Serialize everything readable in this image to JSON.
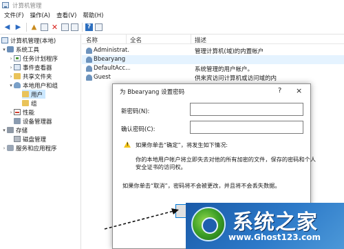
{
  "window": {
    "title": "计算机管理"
  },
  "menu": [
    "文件(F)",
    "操作(A)",
    "查看(V)",
    "帮助(H)"
  ],
  "tree": {
    "root": "计算机管理(本地)",
    "system_tools": "系统工具",
    "task_scheduler": "任务计划程序",
    "event_viewer": "事件查看器",
    "shared_folders": "共享文件夹",
    "local_users_groups": "本地用户和组",
    "users": "用户",
    "groups": "组",
    "performance": "性能",
    "device_manager": "设备管理器",
    "storage": "存储",
    "disk_management": "磁盘管理",
    "services_apps": "服务和应用程序"
  },
  "list": {
    "columns": [
      "名称",
      "全名",
      "描述"
    ],
    "rows": [
      {
        "name": "Administrat...",
        "desc": "管理计算机(域)的内置帐户"
      },
      {
        "name": "Bbearyang",
        "desc": ""
      },
      {
        "name": "DefaultAcc...",
        "desc": "系统管理的用户帐户。"
      },
      {
        "name": "Guest",
        "desc": "供来宾访问计算机或访问域的内"
      }
    ]
  },
  "dialog": {
    "title": "为 Bbearyang 设置密码",
    "help": "?",
    "close": "×",
    "new_password_label": "新密码(N):",
    "confirm_password_label": "确认密码(C):",
    "warning_line": "如果你单击“确定”，将发生如下情况:",
    "consequence_1": "你的本地用户帐户将立即失去对他的所有加密的文件，保存的密码和个人",
    "consequence_2": "安全证书的访问权。",
    "cancel_note": "如果你单击“取消”，密码将不会被更改，并且将不会丢失数据。"
  },
  "watermark": {
    "title": "系统之家",
    "url": "www.Ghost123.com"
  },
  "colors": {
    "selection": "#cce8ff",
    "accent": "#0078d7",
    "watermark_blue": "#1f6bbf"
  }
}
